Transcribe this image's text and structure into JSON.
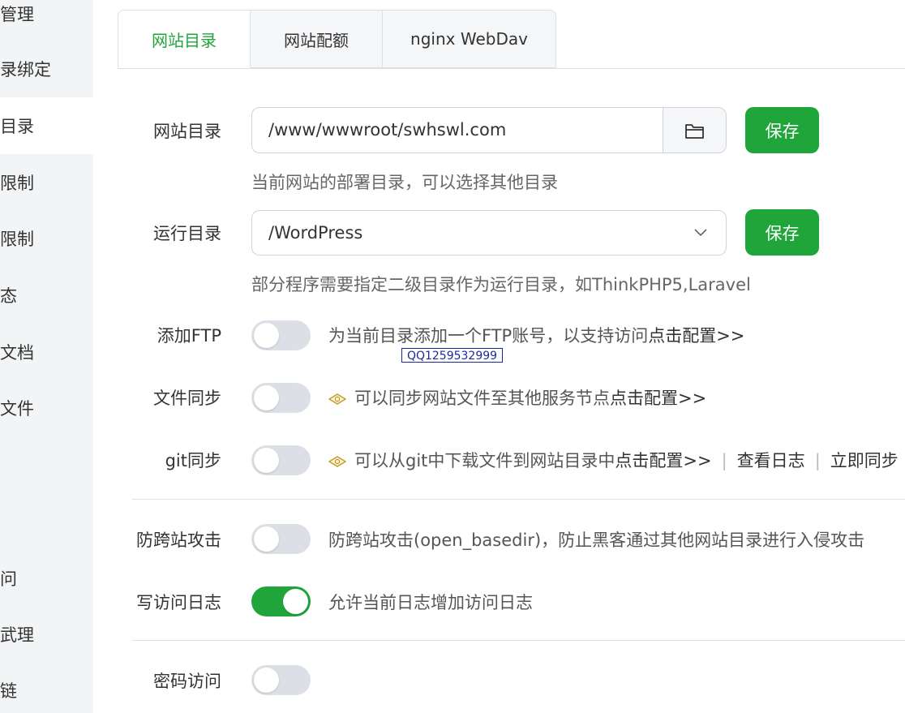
{
  "sidebar": {
    "items": [
      {
        "label": "管理"
      },
      {
        "label": "录绑定"
      },
      {
        "label": "目录"
      },
      {
        "label": "限制"
      },
      {
        "label": "限制"
      },
      {
        "label": "态"
      },
      {
        "label": "文档"
      },
      {
        "label": "文件"
      },
      {
        "label": "问"
      },
      {
        "label": "武理"
      },
      {
        "label": "链"
      }
    ]
  },
  "tabs": [
    {
      "label": "网站目录"
    },
    {
      "label": "网站配额"
    },
    {
      "label": "nginx WebDav"
    }
  ],
  "site_dir": {
    "label": "网站目录",
    "value": "/www/wwwroot/swhswl.com",
    "save_label": "保存",
    "hint": "当前网站的部署目录，可以选择其他目录"
  },
  "run_dir": {
    "label": "运行目录",
    "value": "/WordPress",
    "save_label": "保存",
    "hint": "部分程序需要指定二级目录作为运行目录，如ThinkPHP5,Laravel"
  },
  "ftp": {
    "label": "添加FTP",
    "enabled": false,
    "desc": "为当前目录添加一个FTP账号，以支持访问",
    "link": "点击配置>>"
  },
  "watermark": {
    "text": "QQ1259532999"
  },
  "file_sync": {
    "label": "文件同步",
    "enabled": false,
    "desc": "可以同步网站文件至其他服务节点",
    "link": "点击配置>>"
  },
  "git_sync": {
    "label": "git同步",
    "enabled": false,
    "desc": "可以从git中下载文件到网站目录中",
    "link": "点击配置>>",
    "view_log": "查看日志",
    "sync_now": "立即同步"
  },
  "anti_xss": {
    "label": "防跨站攻击",
    "enabled": false,
    "desc": "防跨站攻击(open_basedir)，防止黑客通过其他网站目录进行入侵攻击"
  },
  "access_log": {
    "label": "写访问日志",
    "enabled": true,
    "desc": "允许当前日志增加访问日志"
  },
  "password_access": {
    "label": "密码访问",
    "enabled": false
  },
  "colors": {
    "accent": "#20a53a"
  }
}
